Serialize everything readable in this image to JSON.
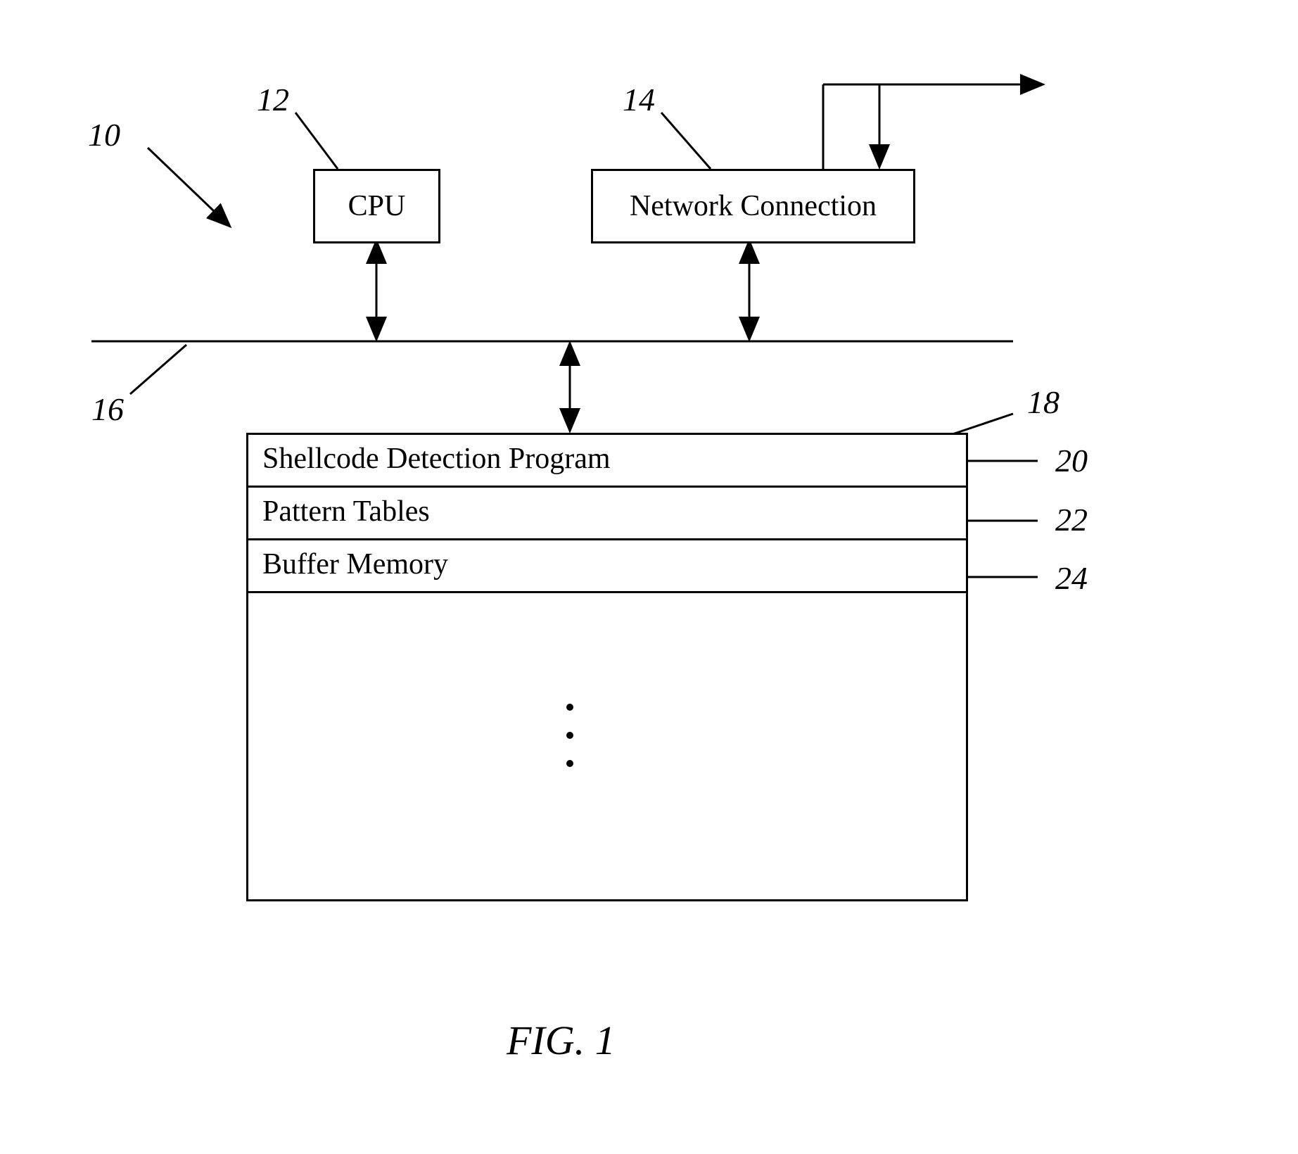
{
  "labels": {
    "ref_10": "10",
    "ref_12": "12",
    "ref_14": "14",
    "ref_16": "16",
    "ref_18": "18",
    "ref_20": "20",
    "ref_22": "22",
    "ref_24": "24"
  },
  "boxes": {
    "cpu": "CPU",
    "network": "Network Connection",
    "row1": "Shellcode Detection Program",
    "row2": "Pattern Tables",
    "row3": "Buffer Memory"
  },
  "figure": "FIG. 1"
}
